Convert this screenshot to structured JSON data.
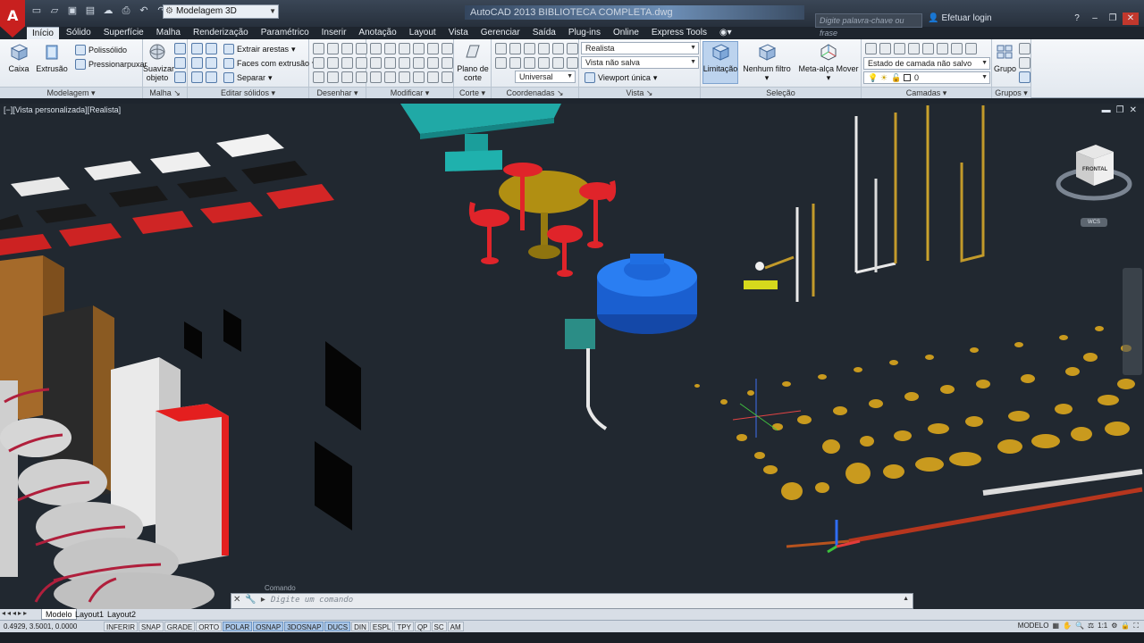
{
  "app": {
    "title": "AutoCAD 2013   BIBLIOTECA COMPLETA.dwg",
    "logo_letter": "A",
    "workspace": "Modelagem 3D",
    "search_placeholder": "Digite palavra-chave ou frase",
    "login_label": "Efetuar login"
  },
  "tabs": [
    "Início",
    "Sólido",
    "Superfície",
    "Malha",
    "Renderização",
    "Paramétrico",
    "Inserir",
    "Anotação",
    "Layout",
    "Vista",
    "Gerenciar",
    "Saída",
    "Plug-ins",
    "Online",
    "Express Tools"
  ],
  "ribbon": {
    "modelagem": {
      "title": "Modelagem",
      "caixa": "Caixa",
      "extrusao": "Extrusão",
      "polissolido": "Polissólido",
      "pressionar": "Pressionarpuxar"
    },
    "malha": {
      "title": "Malha",
      "suavizar": "Suavizar objeto"
    },
    "editar_solidos": {
      "title": "Editar sólidos",
      "extrair": "Extrair arestas",
      "faces": "Faces com extrusão",
      "separar": "Separar"
    },
    "desenhar": {
      "title": "Desenhar"
    },
    "modificar": {
      "title": "Modificar"
    },
    "corte": {
      "title": "Corte",
      "plano": "Plano de corte"
    },
    "coordenadas": {
      "title": "Coordenadas",
      "universal": "Universal"
    },
    "vista": {
      "title": "Vista",
      "estilo": "Realista",
      "vista_nao_salva": "Vista não salva",
      "viewport": "Viewport única"
    },
    "selecao": {
      "title": "Seleção",
      "limitacao": "Limitação",
      "nenhum_filtro": "Nenhum filtro",
      "meta_alca": "Meta-alça Mover"
    },
    "camadas": {
      "title": "Camadas",
      "estado": "Estado de camada não salvo",
      "layer": "0"
    },
    "grupos": {
      "title": "Grupos",
      "grupo": "Grupo"
    }
  },
  "viewport": {
    "label": "[−][Vista personalizada][Realista]",
    "viewcube_face": "FRONTAL",
    "wcs": "WCS"
  },
  "command": {
    "title": "Comando",
    "placeholder": "Digite um comando"
  },
  "layout_tabs": [
    "Modelo",
    "Layout1",
    "Layout2"
  ],
  "status": {
    "coords": "0.4929, 3.5001, 0.0000",
    "buttons": [
      "INFERIR",
      "SNAP",
      "GRADE",
      "ORTO",
      "POLAR",
      "OSNAP",
      "3DOSNAP",
      "DUCS",
      "DIN",
      "ESPL",
      "TPY",
      "QP",
      "SC",
      "AM"
    ],
    "active_buttons": [
      "POLAR",
      "OSNAP",
      "3DOSNAP",
      "DUCS"
    ],
    "model_label": "MODELO",
    "scale": "1:1"
  }
}
